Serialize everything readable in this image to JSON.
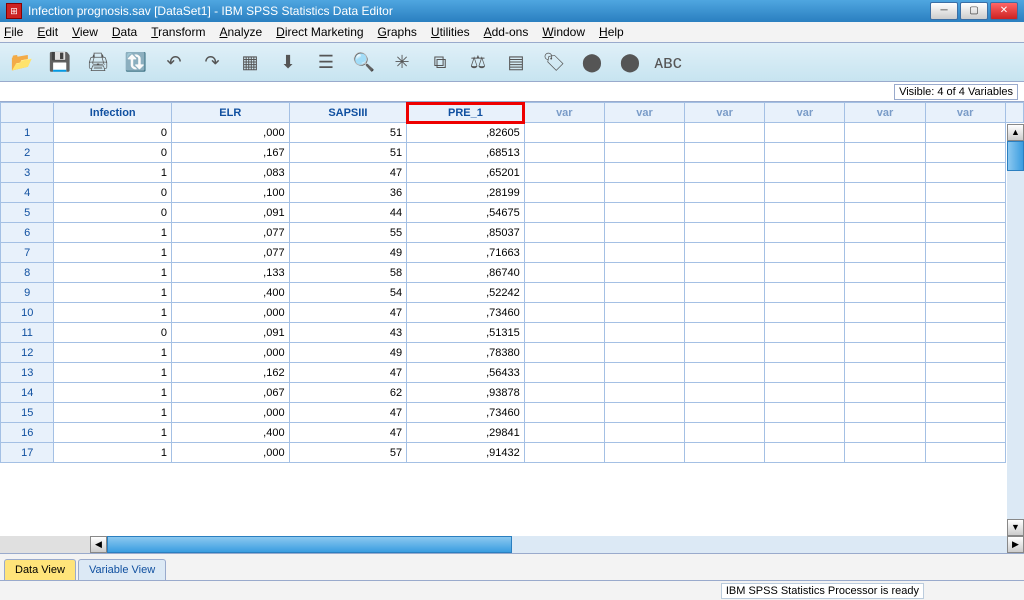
{
  "title": "Infection prognosis.sav [DataSet1] - IBM SPSS Statistics Data Editor",
  "menu": [
    "File",
    "Edit",
    "View",
    "Data",
    "Transform",
    "Analyze",
    "Direct Marketing",
    "Graphs",
    "Utilities",
    "Add-ons",
    "Window",
    "Help"
  ],
  "visible_label": "Visible: 4 of 4 Variables",
  "columns": [
    "Infection",
    "ELR",
    "SAPSIII",
    "PRE_1",
    "var",
    "var",
    "var",
    "var",
    "var",
    "var"
  ],
  "highlight_col": 3,
  "rows": [
    {
      "n": "1",
      "c": [
        "0",
        ",000",
        "51",
        ",82605",
        "",
        "",
        "",
        "",
        "",
        ""
      ]
    },
    {
      "n": "2",
      "c": [
        "0",
        ",167",
        "51",
        ",68513",
        "",
        "",
        "",
        "",
        "",
        ""
      ]
    },
    {
      "n": "3",
      "c": [
        "1",
        ",083",
        "47",
        ",65201",
        "",
        "",
        "",
        "",
        "",
        ""
      ]
    },
    {
      "n": "4",
      "c": [
        "0",
        ",100",
        "36",
        ",28199",
        "",
        "",
        "",
        "",
        "",
        ""
      ]
    },
    {
      "n": "5",
      "c": [
        "0",
        ",091",
        "44",
        ",54675",
        "",
        "",
        "",
        "",
        "",
        ""
      ]
    },
    {
      "n": "6",
      "c": [
        "1",
        ",077",
        "55",
        ",85037",
        "",
        "",
        "",
        "",
        "",
        ""
      ]
    },
    {
      "n": "7",
      "c": [
        "1",
        ",077",
        "49",
        ",71663",
        "",
        "",
        "",
        "",
        "",
        ""
      ]
    },
    {
      "n": "8",
      "c": [
        "1",
        ",133",
        "58",
        ",86740",
        "",
        "",
        "",
        "",
        "",
        ""
      ]
    },
    {
      "n": "9",
      "c": [
        "1",
        ",400",
        "54",
        ",52242",
        "",
        "",
        "",
        "",
        "",
        ""
      ]
    },
    {
      "n": "10",
      "c": [
        "1",
        ",000",
        "47",
        ",73460",
        "",
        "",
        "",
        "",
        "",
        ""
      ]
    },
    {
      "n": "11",
      "c": [
        "0",
        ",091",
        "43",
        ",51315",
        "",
        "",
        "",
        "",
        "",
        ""
      ]
    },
    {
      "n": "12",
      "c": [
        "1",
        ",000",
        "49",
        ",78380",
        "",
        "",
        "",
        "",
        "",
        ""
      ]
    },
    {
      "n": "13",
      "c": [
        "1",
        ",162",
        "47",
        ",56433",
        "",
        "",
        "",
        "",
        "",
        ""
      ]
    },
    {
      "n": "14",
      "c": [
        "1",
        ",067",
        "62",
        ",93878",
        "",
        "",
        "",
        "",
        "",
        ""
      ]
    },
    {
      "n": "15",
      "c": [
        "1",
        ",000",
        "47",
        ",73460",
        "",
        "",
        "",
        "",
        "",
        ""
      ]
    },
    {
      "n": "16",
      "c": [
        "1",
        ",400",
        "47",
        ",29841",
        "",
        "",
        "",
        "",
        "",
        ""
      ]
    },
    {
      "n": "17",
      "c": [
        "1",
        ",000",
        "57",
        ",91432",
        "",
        "",
        "",
        "",
        "",
        ""
      ]
    }
  ],
  "tabs": {
    "data": "Data View",
    "variable": "Variable View"
  },
  "status": "IBM SPSS Statistics Processor is ready"
}
